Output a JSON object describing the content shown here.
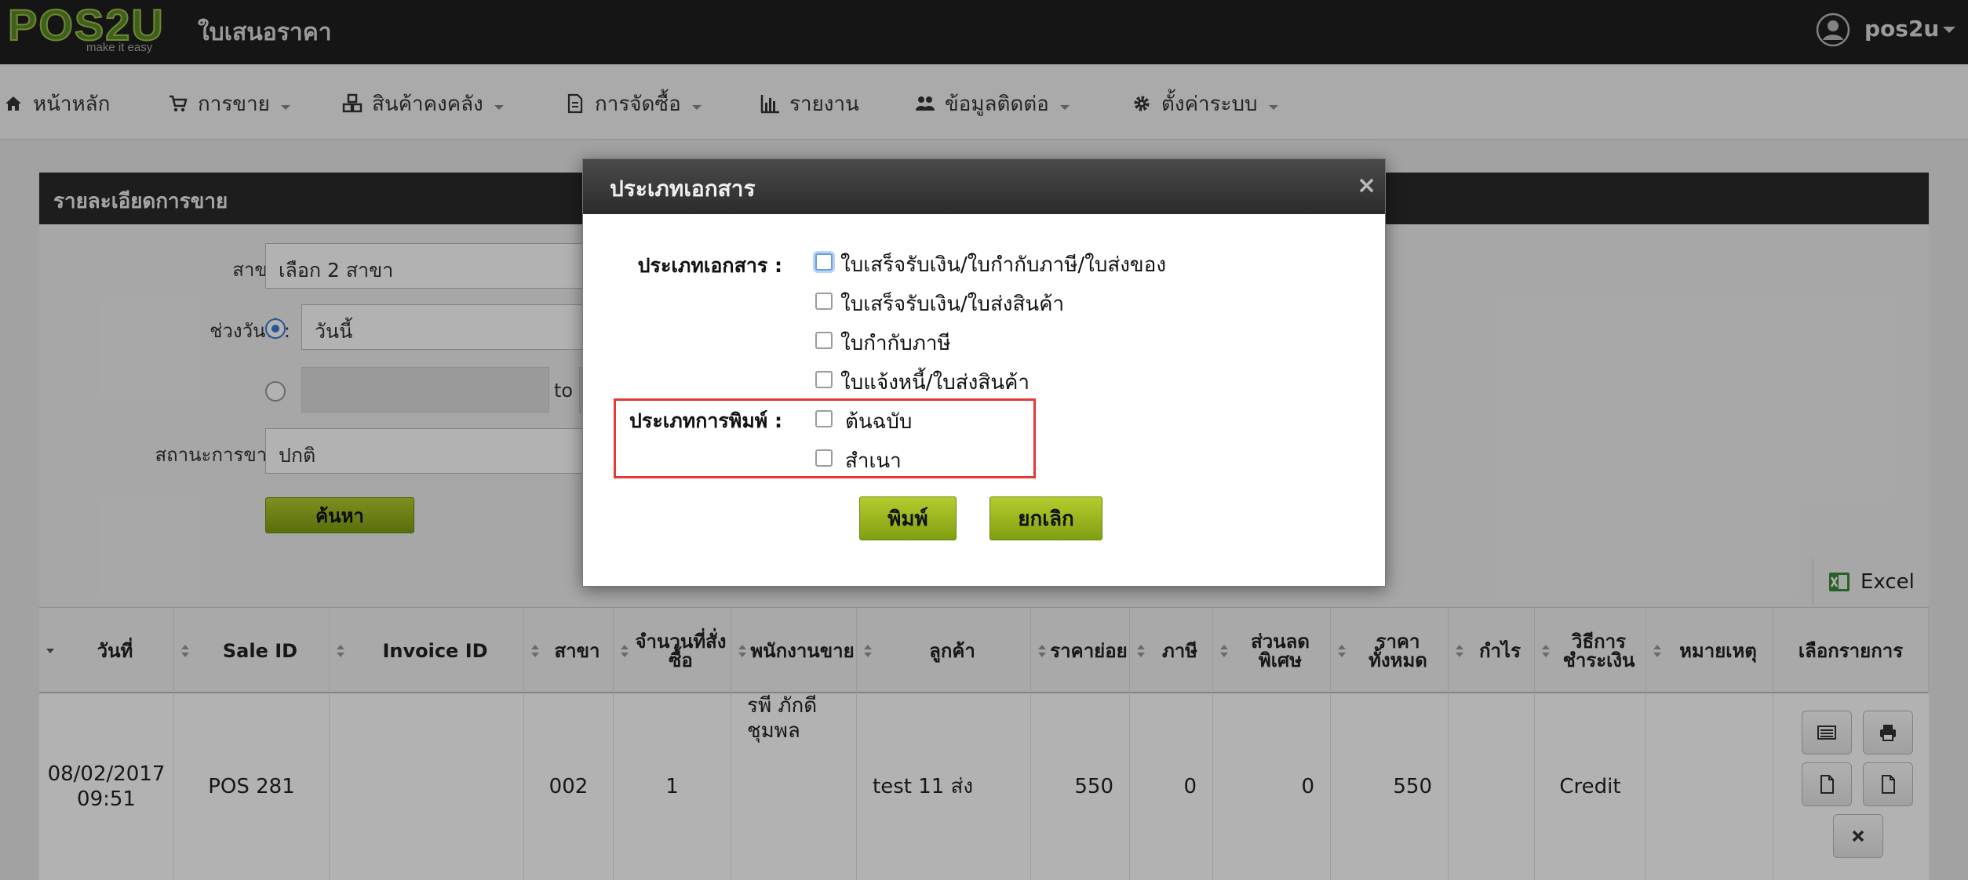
{
  "header": {
    "logo_text": "POS2U",
    "logo_tagline": "make it easy",
    "title": "ใบเสนอราคา",
    "user": "pos2u"
  },
  "nav": {
    "items": [
      {
        "label": "หน้าหลัก",
        "icon": "home-icon",
        "dropdown": false
      },
      {
        "label": "การขาย",
        "icon": "cart-icon",
        "dropdown": true
      },
      {
        "label": "สินค้าคงคลัง",
        "icon": "cubes-icon",
        "dropdown": true
      },
      {
        "label": "การจัดซื้อ",
        "icon": "document-icon",
        "dropdown": true
      },
      {
        "label": "รายงาน",
        "icon": "bar-chart-icon",
        "dropdown": false
      },
      {
        "label": "ข้อมูลติดต่อ",
        "icon": "users-icon",
        "dropdown": true
      },
      {
        "label": "ตั้งค่าระบบ",
        "icon": "gear-icon",
        "dropdown": true
      }
    ]
  },
  "panel": {
    "title": "รายละเอียดการขาย",
    "branch_label": "สาขา :",
    "branch_value": "เลือก 2 สาขา",
    "date_range_label": "ช่วงวันที่ :",
    "date_option_today": "วันนี้",
    "date_to": "to",
    "status_label": "สถานะการขาย :",
    "status_value": "ปกติ",
    "search_button": "ค้นหา",
    "excel_button": "Excel"
  },
  "table": {
    "columns": [
      "วันที่",
      "Sale ID",
      "Invoice ID",
      "สาขา",
      "จำนวนที่สั่งซื้อ",
      "พนักงานขาย",
      "ลูกค้า",
      "ราคาย่อย",
      "ภาษี",
      "ส่วนลดพิเศษ",
      "ราคาทั้งหมด",
      "กำไร",
      "วิธีการชำระเงิน",
      "หมายเหตุ",
      "เลือกรายการ"
    ],
    "rows": [
      {
        "date": "08/02/2017",
        "time": "09:51",
        "sale_id": "POS 281",
        "invoice_id": "",
        "branch": "002",
        "qty": "1",
        "staff_line1": "รพี ภักดี",
        "staff_line2": "ชุมพล",
        "customer": "test 11 ส่ง",
        "subtotal": "550",
        "tax": "0",
        "discount": "0",
        "total": "550",
        "profit": "",
        "payment": "Credit",
        "note": ""
      }
    ]
  },
  "modal": {
    "title": "ประเภทเอกสาร",
    "close": "×",
    "doc_type_label": "ประเภทเอกสาร :",
    "doc_types": [
      "ใบเสร็จรับเงิน/ใบกำกับภาษี/ใบส่งของ",
      "ใบเสร็จรับเงิน/ใบส่งสินค้า",
      "ใบกำกับภาษี",
      "ใบแจ้งหนี้/ใบส่งสินค้า"
    ],
    "print_type_label": "ประเภทการพิมพ์ :",
    "print_types": [
      "ต้นฉบับ",
      "สำเนา"
    ],
    "print_button": "พิมพ์",
    "cancel_button": "ยกเลิก"
  },
  "colors": {
    "topbar": "#1f1f1f",
    "accent_green": "#8fae1b",
    "highlight_red": "#e53935"
  }
}
